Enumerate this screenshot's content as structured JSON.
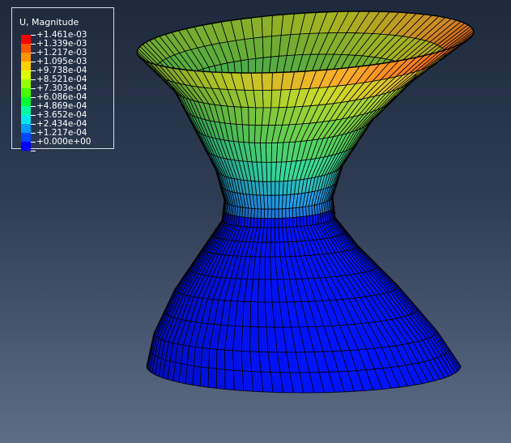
{
  "window": {
    "background_top": "#1e2a3c",
    "background_bottom": "#5c6d85"
  },
  "legend": {
    "title": "U, Magnitude",
    "entries": [
      {
        "label": "+1.461e-03",
        "color": "#ff0000"
      },
      {
        "label": "+1.339e-03",
        "color": "#ff5400"
      },
      {
        "label": "+1.217e-03",
        "color": "#ff9600"
      },
      {
        "label": "+1.095e-03",
        "color": "#ffd200"
      },
      {
        "label": "+9.738e-04",
        "color": "#dcff00"
      },
      {
        "label": "+8.521e-04",
        "color": "#96ff00"
      },
      {
        "label": "+7.303e-04",
        "color": "#46ff00"
      },
      {
        "label": "+6.086e-04",
        "color": "#00ff32"
      },
      {
        "label": "+4.869e-04",
        "color": "#00ffa0"
      },
      {
        "label": "+3.652e-04",
        "color": "#00e6f0"
      },
      {
        "label": "+2.434e-04",
        "color": "#009bff"
      },
      {
        "label": "+1.217e-04",
        "color": "#0046ff"
      },
      {
        "label": "+0.000e+00",
        "color": "#0000ff"
      }
    ]
  },
  "model": {
    "name": "hyperboloid-shell",
    "mesh_color": "#000000",
    "contour_colors": [
      "#0014ff",
      "#1e4fe0",
      "#1ea0ea",
      "#33dc9a",
      "#5ad25a",
      "#8cd23c",
      "#c8dc28",
      "#ffaa28",
      "#ff3c14"
    ]
  }
}
